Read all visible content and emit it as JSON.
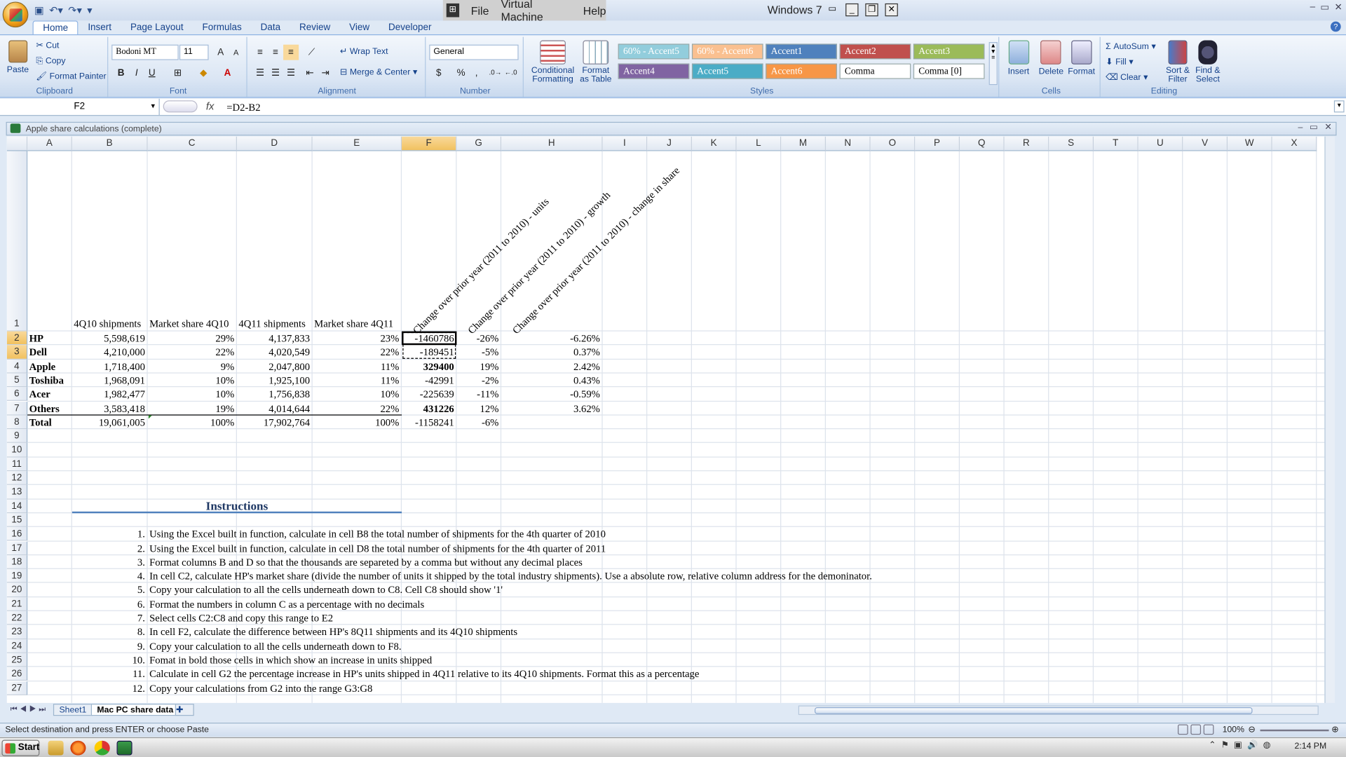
{
  "titlebar": {
    "vm_menu": [
      "File",
      "Virtual Machine",
      "Help"
    ],
    "vm_title": "Windows 7"
  },
  "ribbon_tabs": [
    "Home",
    "Insert",
    "Page Layout",
    "Formulas",
    "Data",
    "Review",
    "View",
    "Developer"
  ],
  "ribbon": {
    "clipboard": {
      "paste": "Paste",
      "cut": "Cut",
      "copy": "Copy",
      "format_painter": "Format Painter",
      "label": "Clipboard"
    },
    "font": {
      "name": "Bodoni MT",
      "size": "11",
      "label": "Font",
      "bold": "B",
      "italic": "I",
      "underline": "U"
    },
    "alignment": {
      "wrap": "Wrap Text",
      "merge": "Merge & Center",
      "label": "Alignment"
    },
    "number": {
      "format": "General",
      "currency": "$",
      "percent": "%",
      "comma": ",",
      "label": "Number"
    },
    "styles": {
      "conditional": "Conditional Formatting",
      "format_table": "Format as Table",
      "label": "Styles",
      "cells": [
        {
          "name": "60% - Accent5",
          "bg": "#92cddc"
        },
        {
          "name": "60% - Accent6",
          "bg": "#fac090"
        },
        {
          "name": "Accent1",
          "bg": "#4f81bd"
        },
        {
          "name": "Accent2",
          "bg": "#c0504d"
        },
        {
          "name": "Accent3",
          "bg": "#9bbb59"
        },
        {
          "name": "Accent4",
          "bg": "#8064a2"
        },
        {
          "name": "Accent5",
          "bg": "#4bacc6"
        },
        {
          "name": "Accent6",
          "bg": "#f79646"
        },
        {
          "name": "Comma",
          "bg": "#ffffff"
        },
        {
          "name": "Comma [0]",
          "bg": "#ffffff"
        }
      ]
    },
    "cells_group": {
      "insert": "Insert",
      "delete": "Delete",
      "format": "Format",
      "label": "Cells"
    },
    "editing": {
      "autosum": "AutoSum",
      "fill": "Fill",
      "clear": "Clear",
      "sort": "Sort & Filter",
      "find": "Find & Select",
      "label": "Editing"
    }
  },
  "formula_bar": {
    "name_box": "F2",
    "fx": "fx",
    "formula": "=D2-B2"
  },
  "workbook": {
    "title": "Apple share calculations (complete)"
  },
  "columns": [
    "A",
    "B",
    "C",
    "D",
    "E",
    "F",
    "G",
    "H",
    "I",
    "J",
    "K",
    "L",
    "M",
    "N",
    "O",
    "P",
    "Q",
    "R",
    "S",
    "T",
    "U",
    "V",
    "W",
    "X"
  ],
  "rows": [
    "1",
    "2",
    "3",
    "4",
    "5",
    "6",
    "7",
    "8",
    "9",
    "10",
    "11",
    "12",
    "13",
    "14",
    "15",
    "16",
    "17",
    "18",
    "19",
    "20",
    "21",
    "22",
    "23",
    "24",
    "25",
    "26",
    "27"
  ],
  "headers": {
    "B": "4Q10 shipments",
    "C": "Market share 4Q10",
    "D": "4Q11 shipments",
    "E": "Market share 4Q11",
    "F": "Change over prior year (2011 to 2010) - units",
    "G": "Change over prior year (2011 to 2010) - growth",
    "H": "Change over prior year (2011 to 2010) - change in share"
  },
  "table": [
    {
      "a": "HP",
      "b": "5,598,619",
      "c": "29%",
      "d": "4,137,833",
      "e": "23%",
      "f": "-1460786",
      "g": "-26%",
      "h": "-6.26%"
    },
    {
      "a": "Dell",
      "b": "4,210,000",
      "c": "22%",
      "d": "4,020,549",
      "e": "22%",
      "f": "-189451",
      "g": "-5%",
      "h": "0.37%"
    },
    {
      "a": "Apple",
      "b": "1,718,400",
      "c": "9%",
      "d": "2,047,800",
      "e": "11%",
      "f": "329400",
      "g": "19%",
      "h": "2.42%"
    },
    {
      "a": "Toshiba",
      "b": "1,968,091",
      "c": "10%",
      "d": "1,925,100",
      "e": "11%",
      "f": "-42991",
      "g": "-2%",
      "h": "0.43%"
    },
    {
      "a": "Acer",
      "b": "1,982,477",
      "c": "10%",
      "d": "1,756,838",
      "e": "10%",
      "f": "-225639",
      "g": "-11%",
      "h": "-0.59%"
    },
    {
      "a": "Others",
      "b": "3,583,418",
      "c": "19%",
      "d": "4,014,644",
      "e": "22%",
      "f": "431226",
      "g": "12%",
      "h": "3.62%"
    },
    {
      "a": "Total",
      "b": "19,061,005",
      "c": "100%",
      "d": "17,902,764",
      "e": "100%",
      "f": "-1158241",
      "g": "-6%",
      "h": ""
    }
  ],
  "instructions_title": "Instructions",
  "instructions": [
    {
      "n": "1.",
      "text": "Using the Excel built in function, calculate in cell B8 the total number of shipments for the 4th quarter of 2010"
    },
    {
      "n": "2.",
      "text": "Using the Excel built in function, calculate in cell D8 the total number of shipments for the 4th quarter of 2011"
    },
    {
      "n": "3.",
      "text": "Format columns B and D so that the thousands are separeted by a comma but without any decimal places"
    },
    {
      "n": "4.",
      "text": "In cell C2, calculate HP's market share (divide the number of units it shipped by the total industry shipments). Use a absolute row, relative column address for the demoninator."
    },
    {
      "n": "5.",
      "text": "Copy your calculation to all the cells underneath down to C8. Cell C8 should show '1'"
    },
    {
      "n": "6.",
      "text": "Format the numbers in column C as a percentage with no decimals"
    },
    {
      "n": "7.",
      "text": "Select cells C2:C8 and copy this range to E2"
    },
    {
      "n": "8.",
      "text": "In cell F2, calculate the difference between HP's 8Q11 shipments and its 4Q10 shipments"
    },
    {
      "n": "9.",
      "text": "Copy your calculation to all the cells underneath down to F8."
    },
    {
      "n": "10.",
      "text": "Fomat in bold those cells in which show an increase in units shipped"
    },
    {
      "n": "11.",
      "text": "Calculate in cell G2 the percentage increase in HP's units shipped in 4Q11 relative to its 4Q10 shipments. Format this as a percentage"
    },
    {
      "n": "12.",
      "text": "Copy your calculations from G2 into the range G3:G8"
    }
  ],
  "sheets": [
    "Sheet1",
    "Mac PC share data"
  ],
  "status": {
    "text": "Select destination and press ENTER or choose Paste",
    "zoom": "100%"
  },
  "taskbar": {
    "start": "Start",
    "time": "2:14 PM"
  }
}
